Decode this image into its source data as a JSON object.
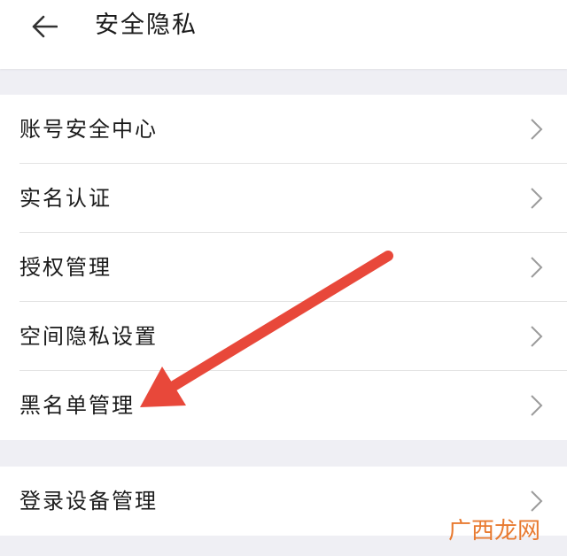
{
  "header": {
    "title": "安全隐私",
    "back_icon": "arrow-left-icon"
  },
  "groups": [
    {
      "items": [
        {
          "label": "账号安全中心"
        },
        {
          "label": "实名认证"
        },
        {
          "label": "授权管理"
        },
        {
          "label": "空间隐私设置"
        },
        {
          "label": "黑名单管理"
        }
      ]
    },
    {
      "items": [
        {
          "label": "登录设备管理"
        }
      ]
    }
  ],
  "annotation": {
    "icon": "red-arrow-icon",
    "color": "#e8483a"
  },
  "watermark": {
    "text": "广西龙网",
    "color": "#e87a30"
  },
  "colors": {
    "background": "#efeff4",
    "surface": "#ffffff",
    "text": "#1b1b1b",
    "chevron": "#9b9b9b",
    "divider": "#e3e3e3"
  }
}
